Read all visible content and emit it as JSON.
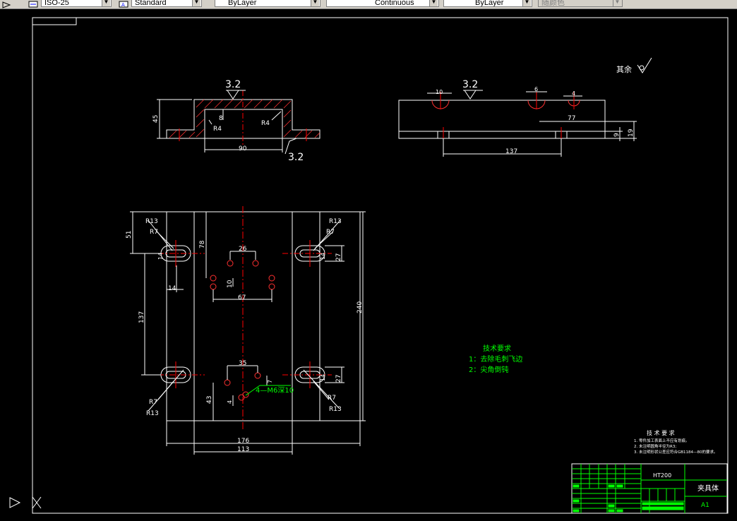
{
  "toolbar": {
    "dimstyle": "ISO-25",
    "textstyle": "Standard",
    "layer_color": "ByLayer",
    "linetype": "Continuous",
    "lineweight": "ByLayer",
    "plot_color": "随颜色"
  },
  "colors": {
    "background": "#000000",
    "geometry": "#ffffff",
    "centerline": "#ff0000",
    "annotation": "#00ff00",
    "hatch": "#ff0000"
  },
  "drawing": {
    "front_view": {
      "roughness_top": "3.2",
      "roughness_bottom": "3.2",
      "dim_height": "45",
      "dim_depth": "8",
      "radius_left": "R4",
      "radius_right": "R4",
      "dim_width": "90"
    },
    "side_view": {
      "roughness": "3.2",
      "dim_hole1": "10",
      "dim_hole2": "6",
      "dim_hole3": "4",
      "dim_77": "77",
      "dim_137": "137",
      "dim_9": "9",
      "dim_19": "19"
    },
    "rest_roughness": "其余",
    "plan_view": {
      "r13_tl": "R13",
      "r7_tl": "R7",
      "r13_tr": "R13",
      "r7_tr": "R7",
      "r7_bl": "R7",
      "r13_bl": "R13",
      "r7_br": "R7",
      "r13_br": "R13",
      "dim_51": "51",
      "dim_78": "78",
      "dim_26": "26",
      "dim_10": "10",
      "dim_67": "67",
      "dim_14_tl": "14",
      "dim_14_bl": "14",
      "dim_14_tr": "14",
      "dim_14_br": "14",
      "dim_27_tr": "27",
      "dim_27_br": "27",
      "dim_137": "137",
      "dim_240": "240",
      "dim_35": "35",
      "dim_7": "7",
      "dim_4": "4",
      "dim_43": "43",
      "dim_176": "176",
      "dim_113": "113",
      "thread_callout": "4—M6深10"
    },
    "tech_requirements": {
      "title": "技术要求",
      "items": [
        "1：去除毛刺飞边",
        "2：尖角倒钝"
      ]
    },
    "tech_small": {
      "title": "技 术 要 求",
      "items": [
        "1. 零件加工表面上不应有划痕。",
        "2. 未注明圆角半径为R3;",
        "3. 未注明形状公差应符合GB1184—80的要求。"
      ]
    },
    "title_block": {
      "material": "HT200",
      "part_name": "夹具体",
      "sheet_size": "A1"
    }
  }
}
